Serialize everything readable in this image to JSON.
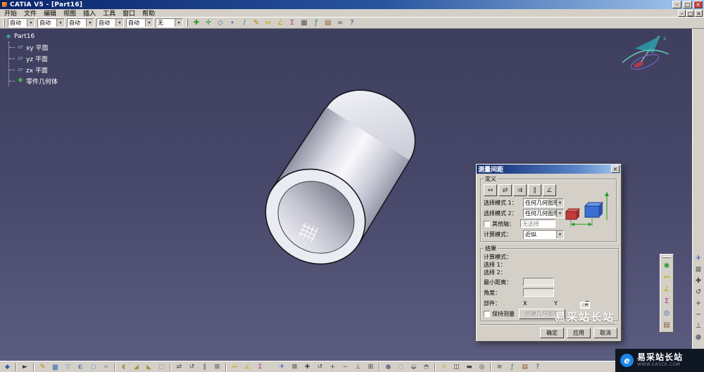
{
  "colors": {
    "titlebar_start": "#0a246a",
    "titlebar_end": "#a6caf0",
    "chrome": "#d4d0c8",
    "viewport_top": "#3e3e5e",
    "viewport_bottom": "#5c5c80",
    "brand_blue": "#1d86e8"
  },
  "titlebar": {
    "title": "CATIA V5 - [Part16]",
    "controls": [
      {
        "name": "minimize-button",
        "glyph": "–"
      },
      {
        "name": "maximize-button",
        "glyph": "□"
      },
      {
        "name": "close-button",
        "glyph": "×",
        "style": "close"
      }
    ]
  },
  "menubar": {
    "items": [
      "开始",
      "文件",
      "编辑",
      "视图",
      "插入",
      "工具",
      "窗口",
      "帮助"
    ],
    "child_controls": [
      {
        "name": "child-minimize-button",
        "glyph": "–"
      },
      {
        "name": "child-restore-button",
        "glyph": "□"
      },
      {
        "name": "child-close-button",
        "glyph": "×"
      }
    ]
  },
  "toolbar": {
    "combos": [
      {
        "value": "自动"
      },
      {
        "value": "自动"
      },
      {
        "value": "自动"
      },
      {
        "value": "自动"
      },
      {
        "value": "自动"
      },
      {
        "value": "无"
      }
    ],
    "icons": [
      {
        "name": "translate-axis-icon",
        "glyph": "✚",
        "color": "#2e9b2e"
      },
      {
        "name": "rotate-axis-icon",
        "glyph": "✛",
        "color": "#2e9b2e"
      },
      {
        "name": "plane-icon",
        "glyph": "◇",
        "color": "#3a6fb0"
      },
      {
        "name": "point-icon",
        "glyph": "∙",
        "color": "#3a6fb0"
      },
      {
        "name": "line-icon",
        "glyph": "∕",
        "color": "#3a6fb0"
      },
      {
        "name": "sketch-icon",
        "glyph": "✎",
        "color": "#c07f00"
      },
      {
        "name": "measure-between-icon",
        "glyph": "↔",
        "color": "#c9a800"
      },
      {
        "name": "measure-item-icon",
        "glyph": "∠",
        "color": "#c9a800"
      },
      {
        "name": "mass-properties-icon",
        "glyph": "Σ",
        "color": "#b03090"
      },
      {
        "name": "grid-icon",
        "glyph": "▦",
        "color": "#555555"
      },
      {
        "name": "formula-icon",
        "glyph": "ƒ",
        "color": "#2e8b57"
      },
      {
        "name": "catalog-icon",
        "glyph": "▤",
        "color": "#8b5a2b"
      },
      {
        "name": "link-icon",
        "glyph": "∞",
        "color": "#555555"
      },
      {
        "name": "help-icon",
        "glyph": "?",
        "color": "#1a4f8b"
      }
    ]
  },
  "tree": {
    "root": {
      "label": "Part16",
      "glyph": "◈",
      "icon": "part-icon",
      "color": "#35b8b8"
    },
    "items": [
      {
        "name": "xy-plane",
        "label": "xy 平面",
        "glyph": "▱",
        "icon": "plane-icon",
        "color": "#a8dce8"
      },
      {
        "name": "yz-plane",
        "label": "yz 平面",
        "glyph": "▱",
        "icon": "plane-icon",
        "color": "#a8dce8"
      },
      {
        "name": "zx-plane",
        "label": "zx 平面",
        "glyph": "▱",
        "icon": "plane-icon",
        "color": "#a8dce8"
      },
      {
        "name": "part-body",
        "label": "零件几何体",
        "glyph": "✚",
        "icon": "part-body-icon",
        "color": "#46c846"
      }
    ]
  },
  "viewport": {
    "watermark": "易采站长站",
    "compass_label": "z"
  },
  "dialog": {
    "title": "测量间距",
    "definition_group": "定义",
    "mode_buttons": [
      {
        "name": "measure-between-mode-button",
        "glyph": "↔"
      },
      {
        "name": "measure-between-chain-mode-button",
        "glyph": "⇄"
      },
      {
        "name": "measure-between-fan-mode-button",
        "glyph": "⇉"
      },
      {
        "name": "measure-thickness-mode-button",
        "glyph": "∥"
      },
      {
        "name": "measure-angle-mode-button",
        "glyph": "∠"
      }
    ],
    "selection1_label": "选择模式 1：",
    "selection1_value": "任何几何图形",
    "selection2_label": "选择模式 2：",
    "selection2_value": "任何几何图形",
    "other_axis_label": "其他轴：",
    "other_axis_value": "无选择",
    "calc_mode_label": "计算模式：",
    "calc_mode_value": "近似",
    "results_group": "结果",
    "result_calc_label": "计算模式：",
    "sel1_result_label": "选择 1：",
    "sel2_result_label": "选择 2：",
    "min_distance_label": "最小距离：",
    "angle_label": "角度：",
    "part_label": "部件：",
    "part_columns": [
      "X",
      "Y",
      "Z"
    ],
    "keep_measure_label": "保持测量",
    "create_geometry_label": "创建几何图形",
    "ok_label": "确定",
    "apply_label": "应用",
    "cancel_label": "取消"
  },
  "right_toolbar": {
    "icons": [
      {
        "name": "fly-mode-icon",
        "glyph": "✈",
        "color": "#3a5fcd"
      },
      {
        "name": "fit-all-icon",
        "glyph": "⊠",
        "color": "#444444"
      },
      {
        "name": "pan-icon",
        "glyph": "✚",
        "color": "#444444"
      },
      {
        "name": "rotate-view-icon",
        "glyph": "↺",
        "color": "#444444"
      },
      {
        "name": "zoom-in-icon",
        "glyph": "+",
        "color": "#444444"
      },
      {
        "name": "zoom-out-icon",
        "glyph": "−",
        "color": "#444444"
      },
      {
        "name": "normal-view-icon",
        "glyph": "⊥",
        "color": "#444444"
      },
      {
        "name": "render-style-icon",
        "glyph": "●",
        "color": "#77778a"
      }
    ]
  },
  "mini_toolbar": {
    "icons": [
      {
        "name": "axis-system-icon",
        "glyph": "◉",
        "color": "#2e9b2e"
      },
      {
        "name": "measure-between-icon",
        "glyph": "↔",
        "color": "#c9a800"
      },
      {
        "name": "measure-item-icon",
        "glyph": "∠",
        "color": "#c9a800"
      },
      {
        "name": "mass-properties-icon",
        "glyph": "Σ",
        "color": "#b03090"
      },
      {
        "name": "compass-tool-icon",
        "glyph": "◎",
        "color": "#2f5fa8"
      },
      {
        "name": "catalog-browser-icon",
        "glyph": "▤",
        "color": "#8b5a2b"
      }
    ]
  },
  "bottom_toolbar": {
    "icons": [
      {
        "name": "workbench-icon",
        "glyph": "◆",
        "color": "#2f5fa8"
      },
      {
        "sep": true
      },
      {
        "name": "select-icon",
        "glyph": "►",
        "color": "#333333"
      },
      {
        "sep": true
      },
      {
        "name": "sketcher-icon",
        "glyph": "✎",
        "color": "#c07f00"
      },
      {
        "name": "pad-icon",
        "glyph": "▆",
        "color": "#6b8cba"
      },
      {
        "name": "pocket-icon",
        "glyph": "▽",
        "color": "#6b8cba"
      },
      {
        "name": "shaft-icon",
        "glyph": "◐",
        "color": "#6b8cba"
      },
      {
        "name": "hole-icon",
        "glyph": "○",
        "color": "#6b8cba"
      },
      {
        "name": "rib-icon",
        "glyph": "≈",
        "color": "#6b8cba"
      },
      {
        "sep": true
      },
      {
        "name": "fillet-icon",
        "glyph": "◖",
        "color": "#9a9a40"
      },
      {
        "name": "chamfer-icon",
        "glyph": "◢",
        "color": "#9a9a40"
      },
      {
        "name": "draft-icon",
        "glyph": "◣",
        "color": "#9a9a40"
      },
      {
        "name": "shell-icon",
        "glyph": "▢",
        "color": "#9a9a40"
      },
      {
        "sep": true
      },
      {
        "name": "translate-icon",
        "glyph": "⇄",
        "color": "#444455"
      },
      {
        "name": "rotate-icon",
        "glyph": "↺",
        "color": "#444455"
      },
      {
        "name": "mirror-icon",
        "glyph": "∥",
        "color": "#444455"
      },
      {
        "name": "pattern-icon",
        "glyph": "⊞",
        "color": "#444455"
      },
      {
        "sep": true
      },
      {
        "name": "measure-between-icon",
        "glyph": "↔",
        "color": "#c9a800"
      },
      {
        "name": "measure-item-icon",
        "glyph": "∠",
        "color": "#c9a800"
      },
      {
        "name": "mass-properties-icon",
        "glyph": "Σ",
        "color": "#b03090"
      },
      {
        "gap": true
      },
      {
        "name": "fly-mode-icon",
        "glyph": "✈",
        "color": "#3a5fcd"
      },
      {
        "name": "fit-all-icon",
        "glyph": "⊠",
        "color": "#444444"
      },
      {
        "name": "pan-icon",
        "glyph": "✚",
        "color": "#444444"
      },
      {
        "name": "rotate-view-icon",
        "glyph": "↺",
        "color": "#444444"
      },
      {
        "name": "zoom-in-icon",
        "glyph": "+",
        "color": "#444444"
      },
      {
        "name": "zoom-out-icon",
        "glyph": "−",
        "color": "#444444"
      },
      {
        "name": "normal-view-icon",
        "glyph": "⊥",
        "color": "#444444"
      },
      {
        "name": "multi-view-icon",
        "glyph": "⊞",
        "color": "#444444"
      },
      {
        "sep": true
      },
      {
        "name": "shading-icon",
        "glyph": "●",
        "color": "#77778a"
      },
      {
        "name": "wireframe-icon",
        "glyph": "◌",
        "color": "#77778a"
      },
      {
        "name": "hide-show-icon",
        "glyph": "◒",
        "color": "#77778a"
      },
      {
        "name": "swap-space-icon",
        "glyph": "◓",
        "color": "#77778a"
      },
      {
        "sep": true
      },
      {
        "name": "sun-light-icon",
        "glyph": "☼",
        "color": "#c9a800"
      },
      {
        "name": "depth-effect-icon",
        "glyph": "◫",
        "color": "#444444"
      },
      {
        "name": "ground-icon",
        "glyph": "▬",
        "color": "#444444"
      },
      {
        "name": "magnifier-icon",
        "glyph": "◎",
        "color": "#444444"
      },
      {
        "sep": true
      },
      {
        "name": "tree-toggle-icon",
        "glyph": "≡",
        "color": "#444444"
      },
      {
        "name": "formula-icon",
        "glyph": "ƒ",
        "color": "#2e8b57"
      },
      {
        "name": "catalog-icon",
        "glyph": "▤",
        "color": "#8b5a2b"
      },
      {
        "name": "help-icon",
        "glyph": "?",
        "color": "#1a4f8b"
      }
    ]
  },
  "brand": {
    "logo_letter": "e",
    "name": "易采站长站",
    "site": "WWW.EASCK.COM"
  }
}
